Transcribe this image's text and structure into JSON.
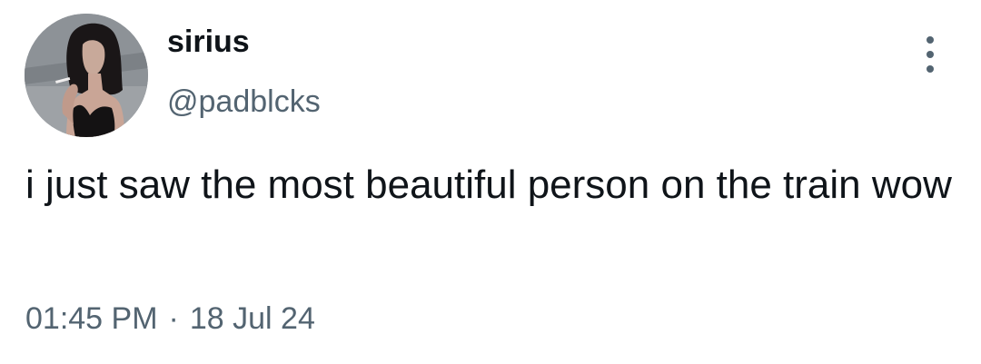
{
  "tweet": {
    "display_name": "sirius",
    "handle": "@padblcks",
    "text": "i just saw the most beautiful person on the train wow",
    "time": "01:45 PM",
    "separator": "·",
    "date": "18 Jul 24"
  },
  "icons": {
    "more": "more-vertical-icon",
    "avatar": "profile-photo"
  },
  "colors": {
    "primary_text": "#0f1419",
    "secondary_text": "#536471",
    "background": "#ffffff"
  }
}
